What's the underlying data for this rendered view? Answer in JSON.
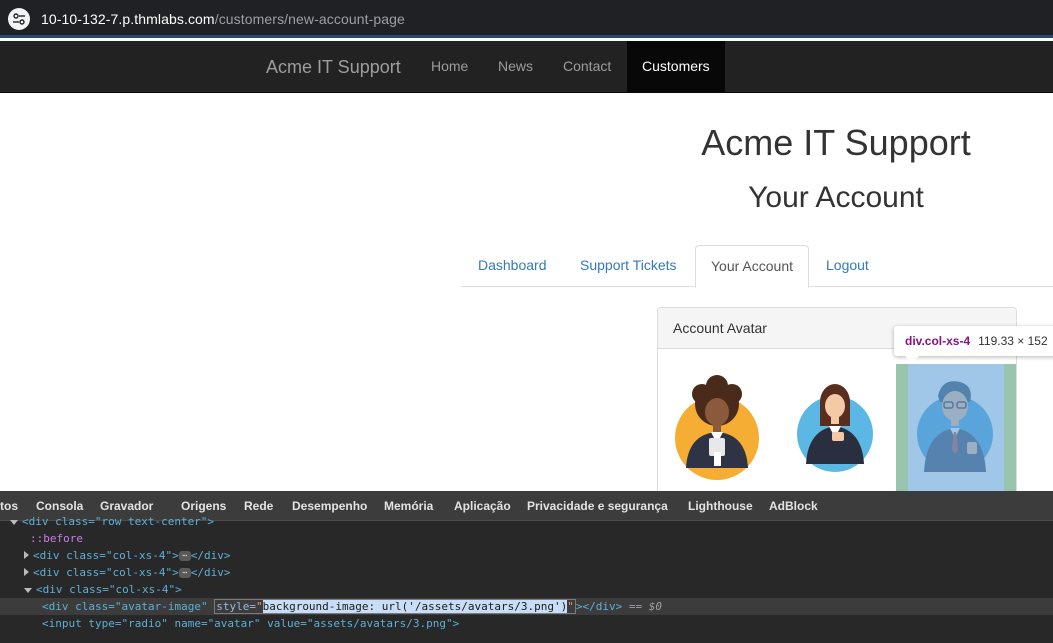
{
  "browser": {
    "url_host": "10-10-132-7.p.thmlabs.com",
    "url_path": "/customers/new-account-page",
    "site_info_icon": "tune-icon"
  },
  "navbar": {
    "brand": "Acme IT Support",
    "items": [
      {
        "label": "Home",
        "active": false
      },
      {
        "label": "News",
        "active": false
      },
      {
        "label": "Contact",
        "active": false
      },
      {
        "label": "Customers",
        "active": true
      }
    ]
  },
  "page": {
    "title": "Acme IT Support",
    "subtitle": "Your Account"
  },
  "tabs": [
    {
      "label": "Dashboard",
      "active": false
    },
    {
      "label": "Support Tickets",
      "active": false
    },
    {
      "label": "Your Account",
      "active": true
    },
    {
      "label": "Logout",
      "active": false
    }
  ],
  "panel": {
    "title": "Account Avatar",
    "avatars": [
      "avatar-woman-curly-hair",
      "avatar-woman-business",
      "avatar-man-glasses"
    ]
  },
  "inspector_tooltip": {
    "tag": "div.col-xs-4",
    "size": "119.33 × 152"
  },
  "devtools": {
    "tabs": [
      "tos",
      "Consola",
      "Gravador",
      "Origens",
      "Rede",
      "Desempenho",
      "Memória",
      "Aplicação",
      "Privacidade e segurança",
      "Lighthouse",
      "AdBlock"
    ],
    "lines": {
      "row_div": "<div class=\"row text-center\">",
      "before": "::before",
      "col1_tag": "<div class=\"col-xs-4\">",
      "col1_close": "</div>",
      "col2_tag": "<div class=\"col-xs-4\">",
      "col2_close": "</div>",
      "col3_tag": "<div class=\"col-xs-4\">",
      "sel_open": "<div class=\"avatar-image\"",
      "sel_attr_name": "style=",
      "sel_attr_value": "background-image: url('/assets/avatars/3.png')",
      "sel_close": "></div>",
      "sel_suffix": "== $0",
      "input_line": "<input type=\"radio\" name=\"avatar\" value=\"assets/avatars/3.png\">"
    }
  }
}
